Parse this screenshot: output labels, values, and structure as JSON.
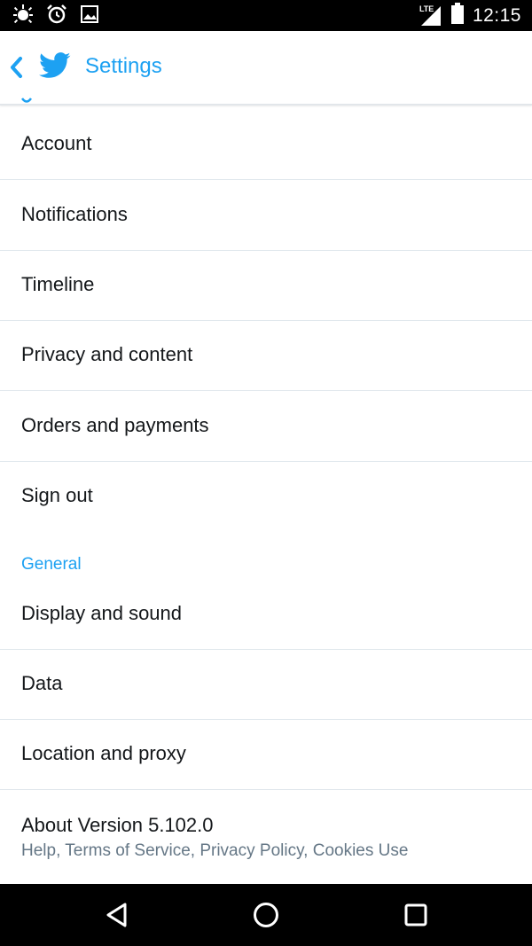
{
  "status_bar": {
    "time": "12:15",
    "network_label": "LTE",
    "icons": [
      "debug-icon",
      "alarm-icon",
      "image-icon",
      "signal-icon",
      "battery-icon"
    ]
  },
  "header": {
    "title": "Settings",
    "back_icon": "chevron-left-icon",
    "logo_icon": "twitter-bird-icon"
  },
  "colors": {
    "accent": "#1da1f2",
    "text": "#14171a",
    "secondary_text": "#657786",
    "divider": "#e1e8ed"
  },
  "account_items": [
    {
      "label": "Account"
    },
    {
      "label": "Notifications"
    },
    {
      "label": "Timeline"
    },
    {
      "label": "Privacy and content"
    },
    {
      "label": "Orders and payments"
    },
    {
      "label": "Sign out"
    }
  ],
  "general": {
    "header": "General",
    "items": [
      {
        "label": "Display and sound"
      },
      {
        "label": "Data"
      },
      {
        "label": "Location and proxy"
      }
    ]
  },
  "about": {
    "title": "About Version 5.102.0",
    "subtitle": "Help, Terms of Service, Privacy Policy, Cookies Use"
  },
  "nav_bar": {
    "icons": [
      "back-triangle-icon",
      "home-circle-icon",
      "recents-square-icon"
    ]
  }
}
